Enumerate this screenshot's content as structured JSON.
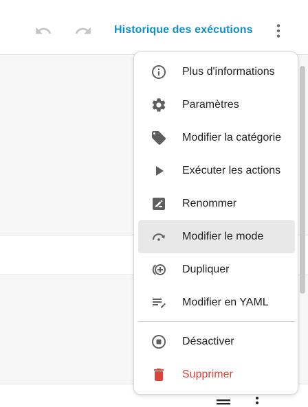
{
  "toolbar": {
    "undo_icon": "undo-icon",
    "redo_icon": "redo-icon",
    "history_label": "Historique des exécutions",
    "more_icon": "more-vertical-icon",
    "link_color": "#0f8fc4"
  },
  "menu": {
    "items": [
      {
        "label": "Plus d'informations",
        "icon": "info-icon"
      },
      {
        "label": "Paramètres",
        "icon": "gear-icon"
      },
      {
        "label": "Modifier la catégorie",
        "icon": "tag-icon"
      },
      {
        "label": "Exécuter les actions",
        "icon": "play-icon"
      },
      {
        "label": "Renommer",
        "icon": "rename-icon"
      },
      {
        "label": "Modifier le mode",
        "icon": "mode-icon",
        "active": true
      },
      {
        "label": "Dupliquer",
        "icon": "duplicate-icon"
      },
      {
        "label": "Modifier en YAML",
        "icon": "edit-yaml-icon"
      },
      {
        "label": "Désactiver",
        "icon": "stop-circle-icon"
      },
      {
        "label": "Supprimer",
        "icon": "trash-icon",
        "danger": true
      }
    ],
    "danger_color": "#db4437"
  },
  "footer": {
    "reorder_icon": "reorder-icon",
    "more_icon": "more-vertical-icon"
  }
}
